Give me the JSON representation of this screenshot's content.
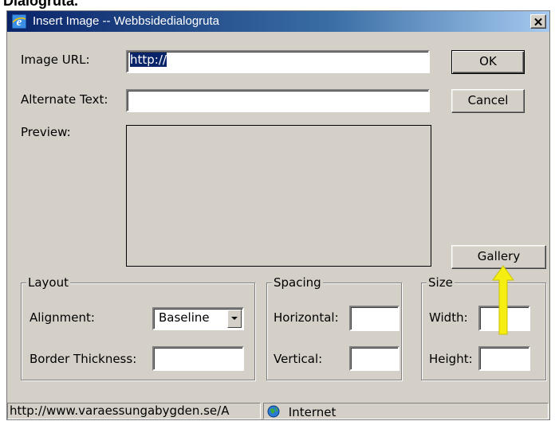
{
  "caption": "Dialogruta.",
  "window": {
    "title": "Insert Image -- Webbsidedialogruta",
    "close_glyph": "✕"
  },
  "fields": {
    "image_url_label": "Image URL:",
    "image_url_value": "http://",
    "alt_text_label": "Alternate Text:",
    "alt_text_value": "",
    "preview_label": "Preview:"
  },
  "buttons": {
    "ok": "OK",
    "cancel": "Cancel",
    "gallery": "Gallery"
  },
  "layout_group": {
    "legend": "Layout",
    "alignment_label": "Alignment:",
    "alignment_value": "Baseline",
    "border_label": "Border Thickness:",
    "border_value": ""
  },
  "spacing_group": {
    "legend": "Spacing",
    "horizontal_label": "Horizontal:",
    "horizontal_value": "",
    "vertical_label": "Vertical:",
    "vertical_value": ""
  },
  "size_group": {
    "legend": "Size",
    "width_label": "Width:",
    "width_value": "",
    "height_label": "Height:",
    "height_value": ""
  },
  "statusbar": {
    "url": "http://www.varaessungabygden.se/A",
    "zone": "Internet"
  },
  "icons": {
    "title_icon": "ie-icon",
    "zone_icon": "globe-icon",
    "annotation": "arrow-up-icon"
  },
  "colors": {
    "titlebar_start": "#0a246a",
    "titlebar_end": "#a6caf0",
    "dialog_bg": "#d4d0c8",
    "arrow": "#f5ee10"
  }
}
